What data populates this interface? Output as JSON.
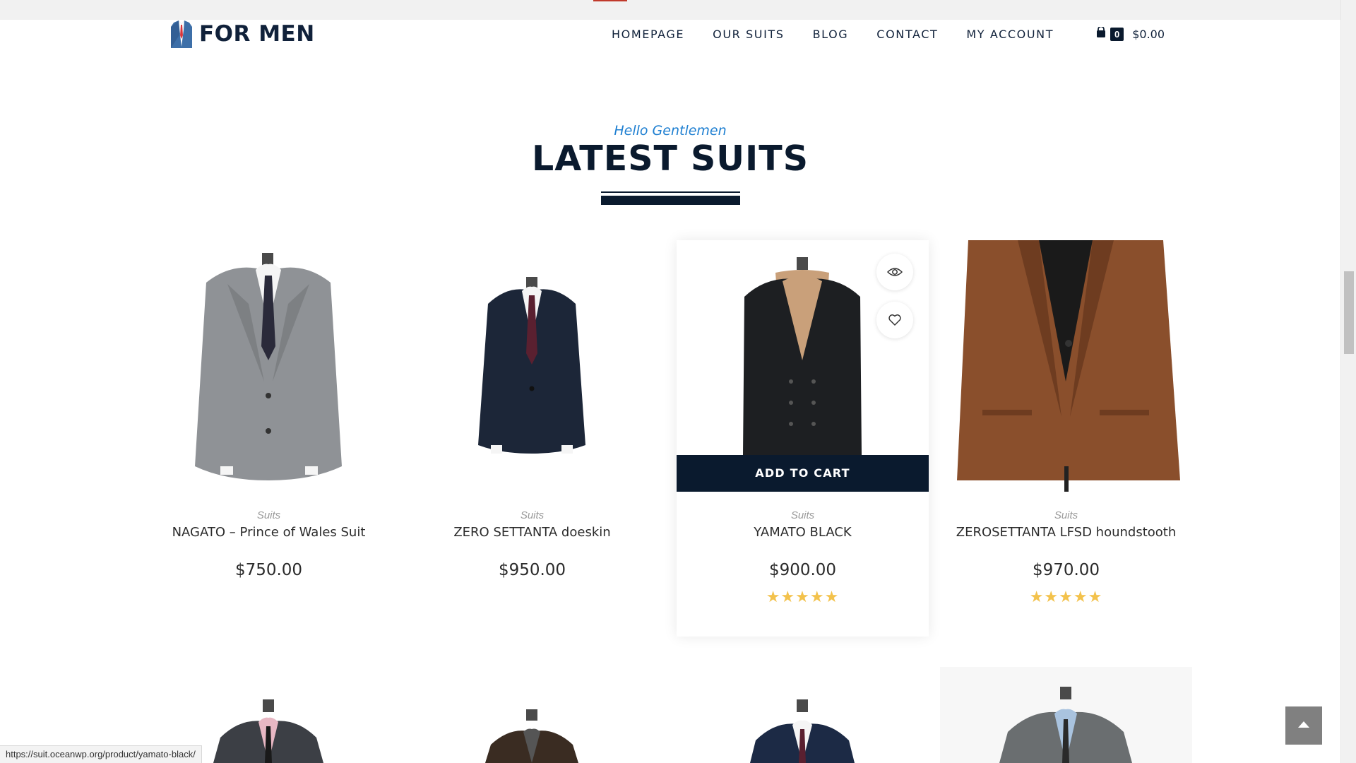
{
  "header": {
    "logo_text": "FOR MEN",
    "nav": [
      "HOMEPAGE",
      "OUR SUITS",
      "BLOG",
      "CONTACT",
      "MY ACCOUNT"
    ],
    "cart_count": "0",
    "cart_total": "$0.00"
  },
  "section": {
    "subtitle": "Hello Gentlemen",
    "title": "LATEST SUITS"
  },
  "products": [
    {
      "category": "Suits",
      "name": "NAGATO – Prince of Wales Suit",
      "price": "$750.00",
      "suit_color": "#8f9296",
      "rating": null
    },
    {
      "category": "Suits",
      "name": "ZERO SETTANTA doeskin",
      "price": "$950.00",
      "suit_color": "#1c2638",
      "rating": null
    },
    {
      "category": "Suits",
      "name": "YAMATO BLACK",
      "price": "$900.00",
      "suit_color": "#1d1f22",
      "rating": 5,
      "stars": "★★★★★",
      "add_to_cart": "ADD TO CART",
      "hovered": true
    },
    {
      "category": "Suits",
      "name": "ZEROSETTANTA LFSD houndstooth",
      "price": "$970.00",
      "suit_color": "#8a4f2c",
      "rating": 5,
      "stars": "★★★★★"
    }
  ],
  "row2_colors": [
    "#3c3f45",
    "#3a2c22",
    "#1c2a45",
    "#6a6e70"
  ],
  "status_url": "https://suit.oceanwp.org/product/yamato-black/",
  "colors": {
    "navy": "#0a1a2e",
    "accent_blue": "#1e7fd1",
    "star": "#f3c24c"
  }
}
